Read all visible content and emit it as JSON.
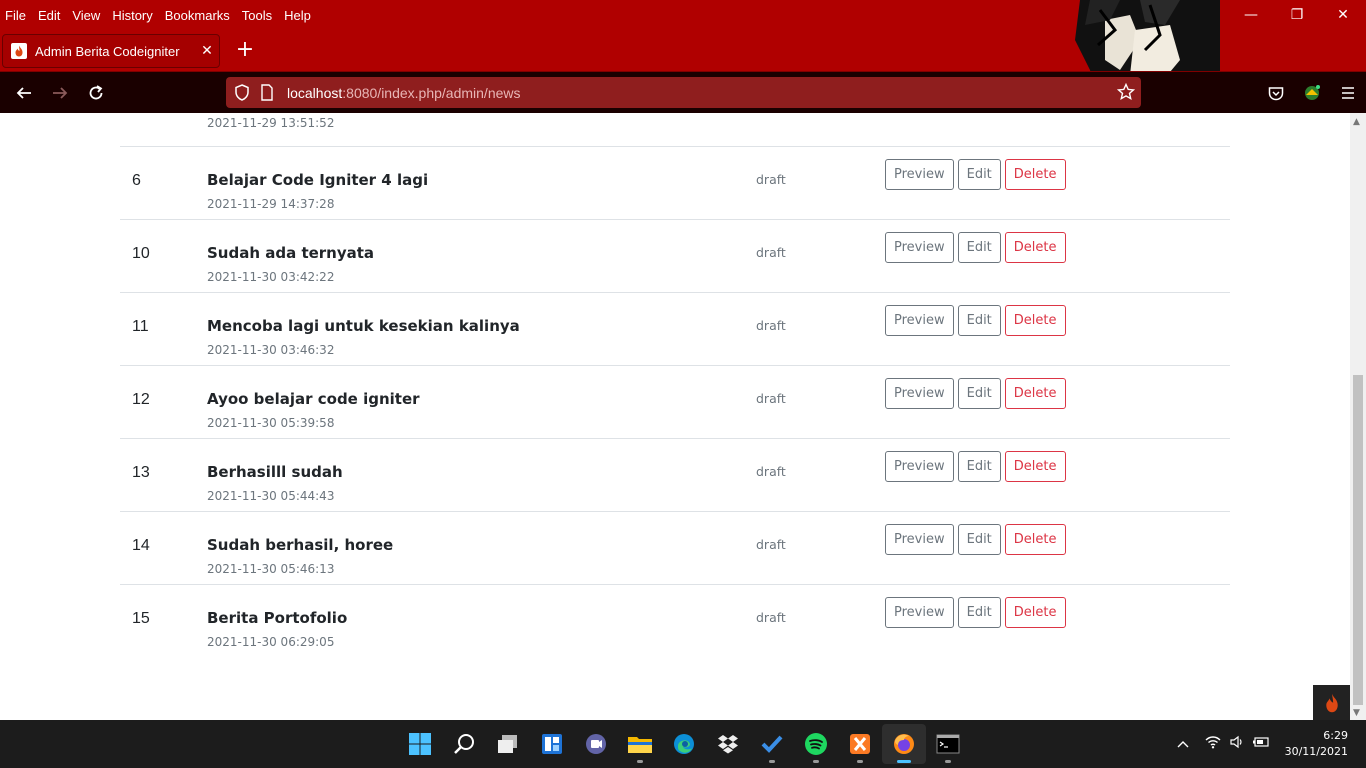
{
  "menubar": {
    "items": [
      "File",
      "Edit",
      "View",
      "History",
      "Bookmarks",
      "Tools",
      "Help"
    ]
  },
  "window_controls": {
    "minimize": "—",
    "restore": "❐",
    "close": "✕"
  },
  "tab": {
    "title": "Admin Berita Codeigniter",
    "close": "✕",
    "new_tab": "+"
  },
  "address_bar": {
    "host": "localhost",
    "path": ":8080/index.php/admin/news"
  },
  "news_table": {
    "partial_row": {
      "date": "2021-11-29 13:51:52"
    },
    "rows": [
      {
        "id": "6",
        "title": "Belajar Code Igniter 4 lagi",
        "date": "2021-11-29 14:37:28",
        "status": "draft"
      },
      {
        "id": "10",
        "title": "Sudah ada ternyata",
        "date": "2021-11-30 03:42:22",
        "status": "draft"
      },
      {
        "id": "11",
        "title": "Mencoba lagi untuk kesekian kalinya",
        "date": "2021-11-30 03:46:32",
        "status": "draft"
      },
      {
        "id": "12",
        "title": "Ayoo belajar code igniter",
        "date": "2021-11-30 05:39:58",
        "status": "draft"
      },
      {
        "id": "13",
        "title": "Berhasilll sudah",
        "date": "2021-11-30 05:44:43",
        "status": "draft"
      },
      {
        "id": "14",
        "title": "Sudah berhasil, horee",
        "date": "2021-11-30 05:46:13",
        "status": "draft"
      },
      {
        "id": "15",
        "title": "Berita Portofolio",
        "date": "2021-11-30 06:29:05",
        "status": "draft"
      }
    ],
    "buttons": {
      "preview": "Preview",
      "edit": "Edit",
      "delete": "Delete"
    }
  },
  "taskbar": {
    "apps": [
      "start-icon",
      "search-icon",
      "task-view-icon",
      "widgets-icon",
      "teams-chat-icon",
      "file-explorer-icon",
      "edge-icon",
      "dropbox-icon",
      "todo-icon",
      "spotify-icon",
      "xampp-icon",
      "firefox-icon",
      "terminal-icon"
    ],
    "time": "6:29",
    "date": "30/11/2021"
  },
  "colors": {
    "chrome": "#b00000",
    "danger": "#dc3545",
    "secondary": "#6c757d"
  }
}
